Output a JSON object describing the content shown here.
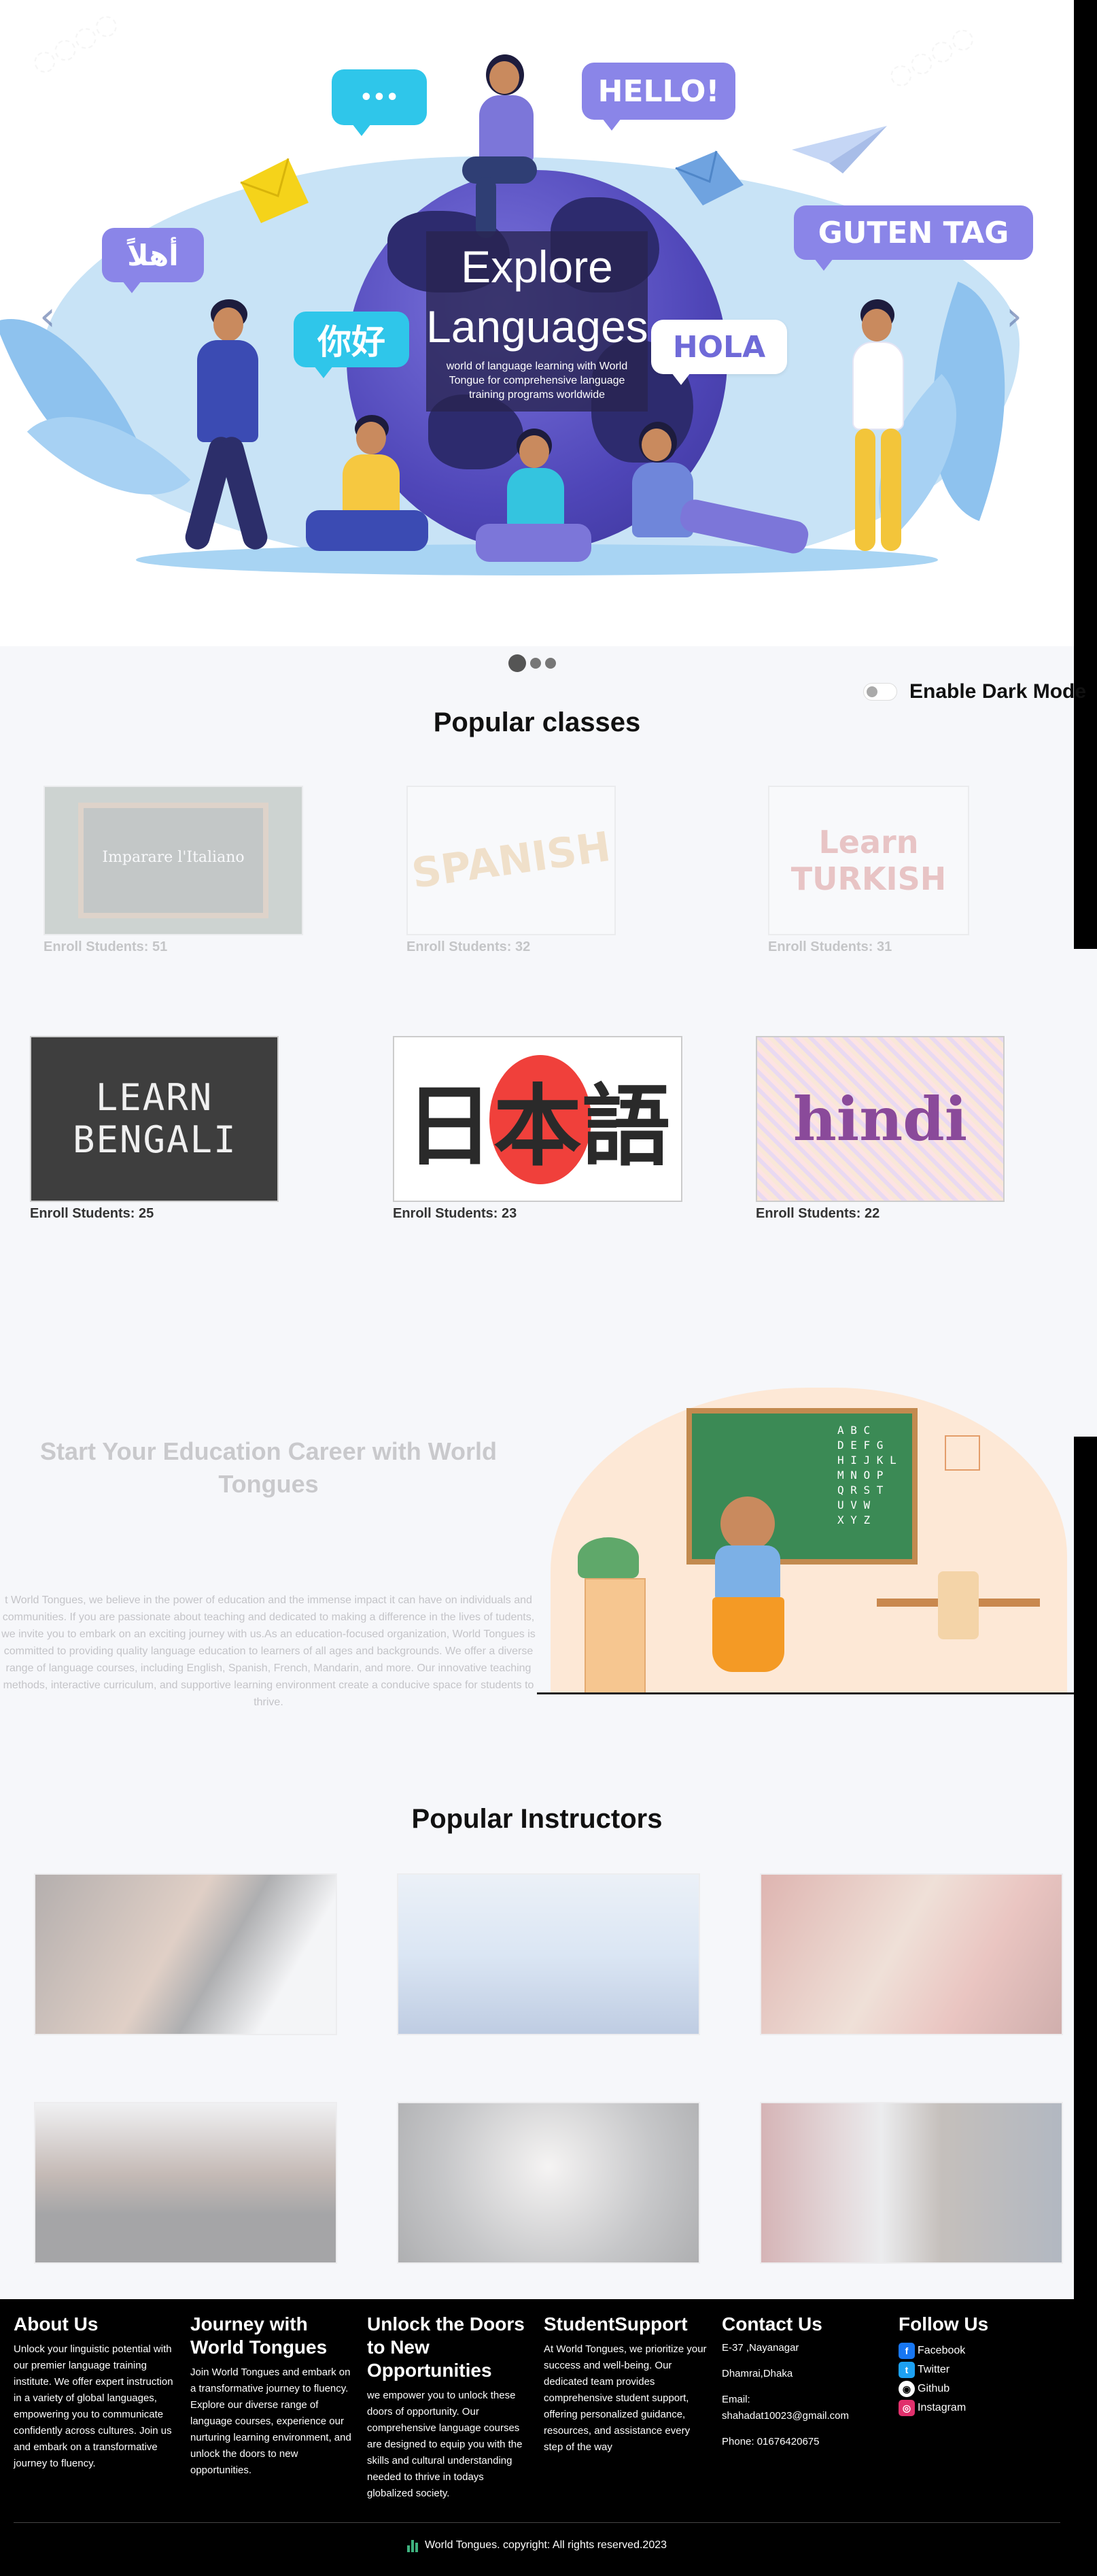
{
  "hero": {
    "title": "Explore Languages",
    "subtitle": "world of language learning with World Tongue for comprehensive language training programs worldwide",
    "bubbles": {
      "hello": "HELLO!",
      "guten_tag": "GUTEN TAG",
      "hola": "HOLA",
      "nihao": "你好",
      "arabic": "أهلاً",
      "dots": "•••"
    },
    "prev_arrow": "‹",
    "next_arrow": "›",
    "slides_total": 3,
    "active_slide": 1
  },
  "dark_mode": {
    "label": "Enable Dark Mode",
    "enabled": false
  },
  "popular_classes": {
    "title": "Popular classes",
    "classes": [
      {
        "image_text": "Imparare l'Italiano",
        "enroll": "Enroll Students: 51"
      },
      {
        "image_text": "SPANISH",
        "enroll": "Enroll Students: 32"
      },
      {
        "image_text": "Learn TURKISH",
        "enroll": "Enroll Students: 31"
      },
      {
        "image_text": "LEARN BENGALI",
        "enroll": "Enroll Students: 25"
      },
      {
        "image_text": "日本語",
        "enroll": "Enroll Students: 23"
      },
      {
        "image_text": "hindi",
        "enroll": "Enroll Students: 22"
      }
    ]
  },
  "career": {
    "title": "Start Your Education Career with World Tongues",
    "text": "t World Tongues, we believe in the power of education and the immense impact it can have on individuals and communities. If you are passionate about teaching and dedicated to making a difference in the lives of tudents, we invite you to embark on an exciting journey with us.As an education-focused organization, World Tongues is committed to providing quality language education to learners of all ages and backgrounds. We offer a diverse range of language courses, including English, Spanish, French, Mandarin, and more. Our innovative teaching methods, interactive curriculum, and supportive learning environment create a conducive space for students to thrive.",
    "board_letters": [
      "A B C",
      "D E F G",
      "H I J K L",
      "M N O P",
      "Q R S T",
      "U V W",
      "X Y Z"
    ]
  },
  "popular_instructors": {
    "title": "Popular Instructors"
  },
  "footer": {
    "about": {
      "title": "About Us",
      "text": "Unlock your linguistic potential with our premier language training institute. We offer expert instruction in a variety of global languages, empowering you to communicate confidently across cultures. Join us and embark on a transformative journey to fluency."
    },
    "journey": {
      "title": "Journey with World Tongues",
      "text": "Join World Tongues and embark on a transformative journey to fluency. Explore our diverse range of language courses, experience our nurturing learning environment, and unlock the doors to new opportunities."
    },
    "unlock": {
      "title": "Unlock the Doors to New Opportunities",
      "text": "we empower you to unlock these doors of opportunity. Our comprehensive language courses are designed to equip you with the skills and cultural understanding needed to thrive in todays globalized society."
    },
    "support": {
      "title": "StudentSupport",
      "text": "At World Tongues, we prioritize your success and well-being. Our dedicated team provides comprehensive student support, offering personalized guidance, resources, and assistance every step of the way"
    },
    "contact": {
      "title": "Contact Us",
      "address1": "E-37 ,Nayanagar",
      "address2": "Dhamrai,Dhaka",
      "email_label": "Email:",
      "email": "shahadat10023@gmail.com",
      "phone": "Phone: 01676420675"
    },
    "follow": {
      "title": "Follow Us",
      "links": [
        {
          "label": "Facebook",
          "icon": "facebook-icon",
          "glyph": "f",
          "color": "#1877f2"
        },
        {
          "label": "Twitter",
          "icon": "twitter-icon",
          "glyph": "t",
          "color": "#1da1f2"
        },
        {
          "label": "Github",
          "icon": "github-icon",
          "glyph": "◉",
          "color": "#ffffff"
        },
        {
          "label": "Instagram",
          "icon": "instagram-icon",
          "glyph": "◎",
          "color": "#e1306c"
        }
      ]
    },
    "copyright": "World Tongues. copyright: All rights reserved.2023"
  }
}
